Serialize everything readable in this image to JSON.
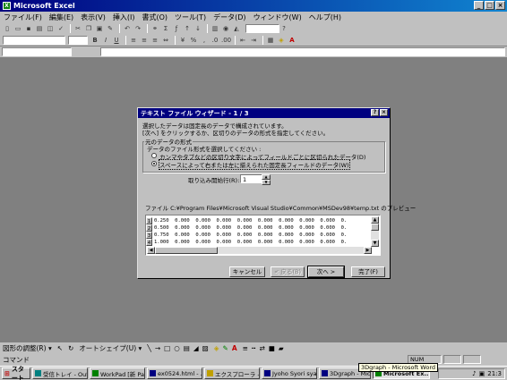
{
  "window": {
    "title": "Microsoft Excel",
    "app_icon": "excel-icon"
  },
  "menu": [
    "ファイル(F)",
    "編集(E)",
    "表示(V)",
    "挿入(I)",
    "書式(O)",
    "ツール(T)",
    "データ(D)",
    "ウィンドウ(W)",
    "ヘルプ(H)"
  ],
  "wizard": {
    "title": "テキスト ファイル ウィザード - 1 / 3",
    "line1": "選択したデータは固定長のデータで構成されています。",
    "line2": "[次へ] をクリックするか、区切りのデータの形式を指定してください。",
    "group_label": "元のデータの形式",
    "instruction": "データのファイル形式を選択してください :",
    "option_delimited": "カンマやタブなどの区切り文字によってフィールドごとに区切られたデータ(D)",
    "option_fixed": "スペースによって右または左に揃えられた固定長フィールドのデータ(W)",
    "selected": "fixed",
    "start_row_label": "取り込み開始行(R):",
    "start_row_value": "1",
    "preview_label": "ファイル C:¥Program Files¥Microsoft Visual Studio¥Common¥MSDev98¥temp.txt のプレビュー",
    "preview_rows": [
      {
        "n": "1",
        "text": "0.250  0.000  0.000  0.000  0.000  0.000  0.000  0.000  0.000  0."
      },
      {
        "n": "2",
        "text": "0.500  0.000  0.000  0.000  0.000  0.000  0.000  0.000  0.000  0."
      },
      {
        "n": "3",
        "text": "0.750  0.000  0.000  0.000  0.000  0.000  0.000  0.000  0.000  0."
      },
      {
        "n": "4",
        "text": "1.000  0.000  0.000  0.000  0.000  0.000  0.000  0.000  0.000  0."
      }
    ],
    "buttons": {
      "cancel": "キャンセル",
      "back": "< 戻る(B)",
      "next": "次へ >",
      "finish": "完了(F)"
    }
  },
  "drawbar": {
    "draw": "図形の調整(R) ▾",
    "autoshapes": "オートシェイプ(U) ▾"
  },
  "status": {
    "text": "コマンド",
    "num": "NUM"
  },
  "taskbar": {
    "start": "スタート",
    "tasks": [
      "受信トレイ - Out...",
      "WorkPad [新 Pal...",
      "ex0524.html - ...",
      "エクスプローラ - ...",
      "Jyoho Syori sya...",
      "3Dgraph - Micro...",
      "Microsoft Ex..."
    ],
    "clock": "21:3"
  },
  "tooltip": "3Dgraph - Microsoft Word"
}
